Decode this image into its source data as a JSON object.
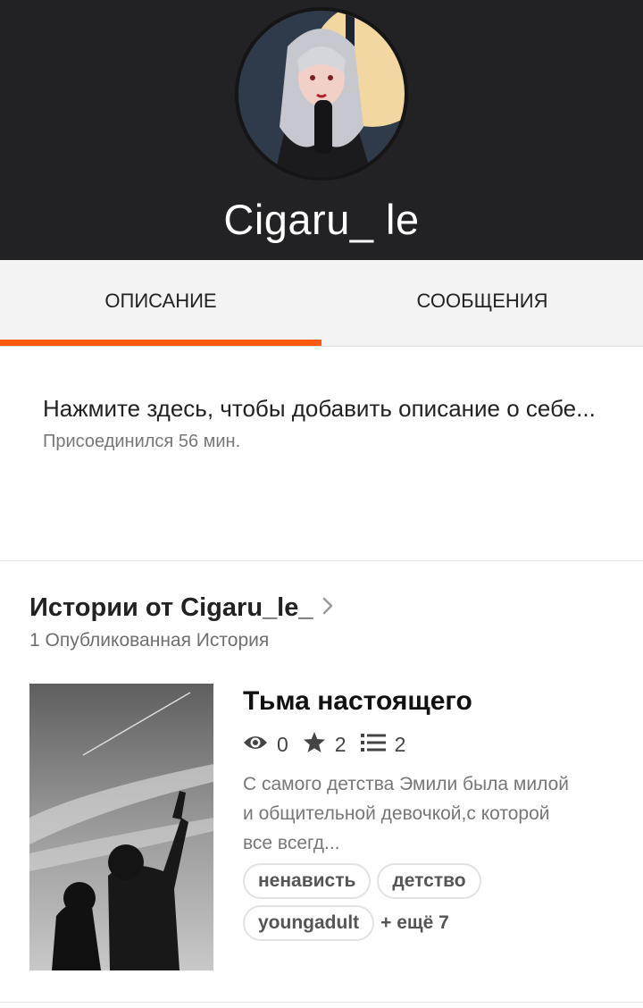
{
  "profile": {
    "username": "Cigaru_ le"
  },
  "tabs": [
    {
      "label": "ОПИСАНИЕ",
      "active": true
    },
    {
      "label": "СООБЩЕНИЯ",
      "active": false
    }
  ],
  "about": {
    "prompt": "Нажмите здесь, чтобы добавить описание о себе...",
    "joined": "Присоединился 56 мин."
  },
  "stories": {
    "title": "Истории от Cigaru_le_",
    "count_text": "1 Опубликованная История",
    "items": [
      {
        "title": "Тьма настоящего",
        "stats": {
          "views": "0",
          "votes": "2",
          "parts": "2"
        },
        "synopsis": "С самого детства Эмили была милой и общительной девочкой,с которой все всегд...",
        "tags": [
          "ненависть",
          "детство",
          "youngadult"
        ],
        "more_tags": "+ ещё 7"
      }
    ]
  },
  "icons": {
    "views": "eye-icon",
    "votes": "star-icon",
    "parts": "list-icon",
    "chevron": "chevron-right-icon"
  },
  "colors": {
    "header_bg": "#222124",
    "accent": "#ff5a0a",
    "tab_bg": "#f3f3f3"
  }
}
